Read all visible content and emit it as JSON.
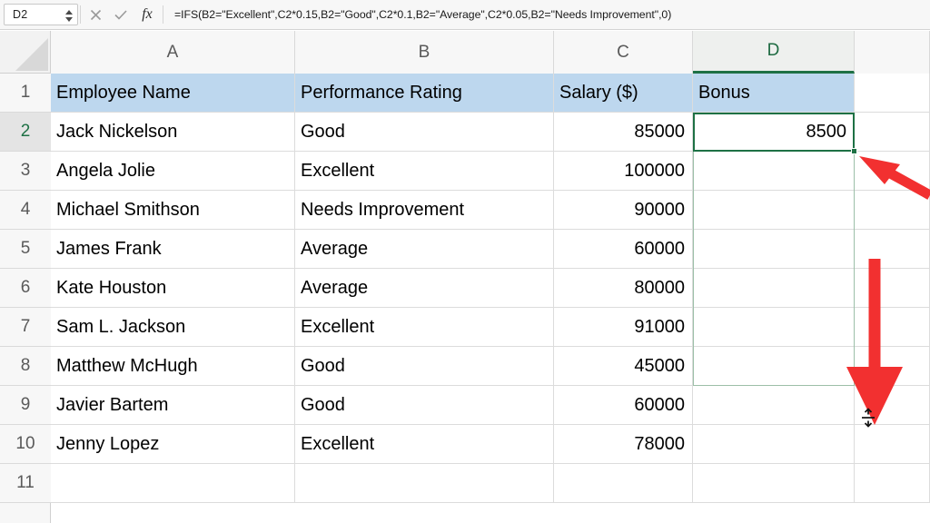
{
  "app": {
    "name_box_value": "D2",
    "formula": "=IFS(B2=\"Excellent\",C2*0.15,B2=\"Good\",C2*0.1,B2=\"Average\",C2*0.05,B2=\"Needs Improvement\",0)",
    "cancel_icon": "close-icon",
    "confirm_icon": "check-icon",
    "function_icon": "fx",
    "name_box_spinner_icon": "spinner-arrows-icon",
    "select_all_icon": "select-all-triangle-icon"
  },
  "grid": {
    "column_headers": [
      "A",
      "B",
      "C",
      "D"
    ],
    "active_column": "D",
    "row_headers": [
      "1",
      "2",
      "3",
      "4",
      "5",
      "6",
      "7",
      "8",
      "9",
      "10",
      "11"
    ],
    "active_row": "2",
    "header_fill_color": "#bdd7ee",
    "active_border_color": "#1e7145",
    "range_border_color": "#9cbfa8",
    "table_headers": [
      "Employee Name",
      "Performance Rating",
      "Salary ($)",
      "Bonus"
    ],
    "rows": [
      {
        "name": "Jack Nickelson",
        "rating": "Good",
        "salary": "85000",
        "bonus": "8500"
      },
      {
        "name": "Angela Jolie",
        "rating": "Excellent",
        "salary": "100000",
        "bonus": ""
      },
      {
        "name": "Michael Smithson",
        "rating": "Needs Improvement",
        "salary": "90000",
        "bonus": ""
      },
      {
        "name": "James Frank",
        "rating": "Average",
        "salary": "60000",
        "bonus": ""
      },
      {
        "name": "Kate Houston",
        "rating": "Average",
        "salary": "80000",
        "bonus": ""
      },
      {
        "name": "Sam L. Jackson",
        "rating": "Excellent",
        "salary": "91000",
        "bonus": ""
      },
      {
        "name": "Matthew McHugh",
        "rating": "Good",
        "salary": "45000",
        "bonus": ""
      },
      {
        "name": "Javier Bartem",
        "rating": "Good",
        "salary": "60000",
        "bonus": ""
      },
      {
        "name": "Jenny Lopez",
        "rating": "Excellent",
        "salary": "78000",
        "bonus": ""
      }
    ]
  },
  "annotations": {
    "arrow_color": "#f23030",
    "fill_handle_arrow_icon": "arrow-up-left-icon",
    "drag_down_arrow_icon": "arrow-down-icon",
    "cursor_icon": "row-resize-cursor-icon"
  }
}
